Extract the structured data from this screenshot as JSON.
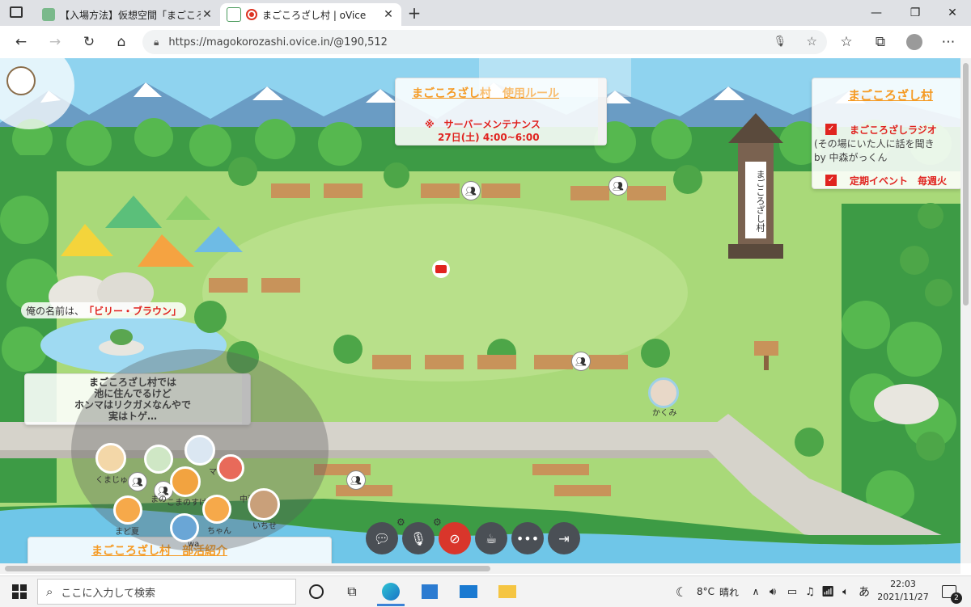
{
  "browser": {
    "tabs": [
      {
        "title": "【入場方法】仮想空間「まごころざし村」"
      },
      {
        "title": "まごころざし村 | oVice"
      }
    ],
    "new_tab": "+",
    "url": "https://magokorozashi.ovice.in/@190,512"
  },
  "room": {
    "rules_panel": {
      "title": "まごころざし村　使用ルール",
      "line1": "※　サーバーメンテナンス",
      "line2": "27日(土) 4:00~6:00"
    },
    "info_panel": {
      "title": "まごころざし村",
      "item1": "まごころざしラジオ",
      "item1_desc": "(その場にいた人に話を聞き",
      "item1_by": "by 中森がっくん",
      "item2": "定期イベント　毎週火"
    },
    "tower_sign": "まごころざし村",
    "name_bubble_prefix": "俺の名前は、",
    "name_bubble_name": "「ビリー・ブラウン」",
    "turtle_note": {
      "line1": "まごころざし村では",
      "line2": "池に住んでるけど",
      "line3": "ホンマはリクガメなんやで",
      "line4": "実はトゲ…"
    },
    "club_panel_title": "まごころざし村　部活紹介",
    "users": [
      {
        "name": "かくみ"
      },
      {
        "name": "くまじゅ"
      },
      {
        "name": "まの"
      },
      {
        "name": "ママ"
      },
      {
        "name": "こまのすけ"
      },
      {
        "name": "中西"
      },
      {
        "name": "まど夏"
      },
      {
        "name": "ちゃん"
      },
      {
        "name": "いちせ"
      },
      {
        "name": "wa"
      }
    ]
  },
  "controls": [
    "chat-icon",
    "mic-icon",
    "camera-off-icon",
    "coffee-icon",
    "more-icon",
    "exit-icon"
  ],
  "taskbar": {
    "search_placeholder": "ここに入力して検索",
    "weather_temp": "8°C",
    "weather_text": "晴れ",
    "ime": "あ",
    "time": "22:03",
    "date": "2021/11/27",
    "notif_count": "2"
  }
}
